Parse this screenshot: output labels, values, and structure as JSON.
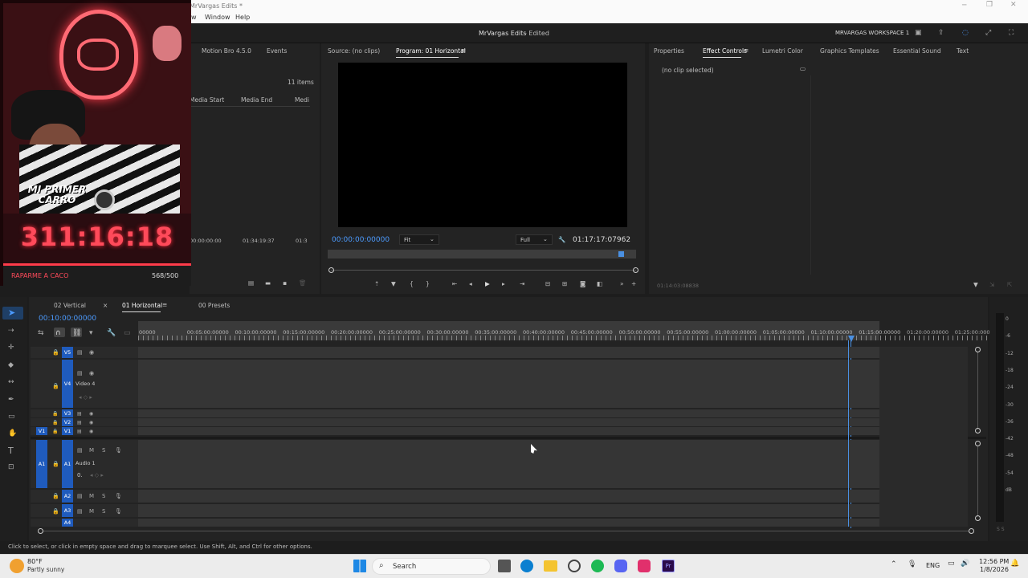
{
  "window": {
    "title_fragment": "MrVargas Edits *",
    "menu_fragment": "w",
    "menu": [
      "Window",
      "Help"
    ]
  },
  "workbar": {
    "project_title": "MrVargas Edits",
    "status": "- Edited",
    "workspace": "MRVARGAS WORKSPACE 1"
  },
  "overlay": {
    "headline": "MI PRIMER\nCARRO",
    "counter": "311:16:18",
    "goal_label": "RAPARME A CACO",
    "goal_count": "568/500"
  },
  "project_panel": {
    "tabs": [
      "Motion Bro 4.5.0",
      "Events"
    ],
    "items_count": "11 items",
    "columns": [
      "Media Start",
      "Media End",
      "Medi"
    ],
    "row": [
      "00:00:00:00",
      "01:34:19:37",
      "01:3"
    ]
  },
  "source_tab": "Source: (no clips)",
  "program_monitor": {
    "tab": "Program: 01 Horizontal",
    "timecode": "00:00:00:00000",
    "fit": "Fit",
    "quality": "Full",
    "duration": "01:17:17:07962"
  },
  "effects_panel": {
    "tabs": [
      "Properties",
      "Effect Controls",
      "Lumetri Color",
      "Graphics Templates",
      "Essential Sound",
      "Text"
    ],
    "active": "Effect Controls",
    "no_clip": "(no clip selected)",
    "timecode": "01:14:03:08838"
  },
  "timeline": {
    "tabs": [
      "02 Vertical",
      "01 Horizontal",
      "00 Presets"
    ],
    "active": "01 Horizontal",
    "timecode": "00:10:00:00000",
    "ruler": [
      "00000",
      "00:05:00:00000",
      "00:10:00:00000",
      "00:15:00:00000",
      "00:20:00:00000",
      "00:25:00:00000",
      "00:30:00:00000",
      "00:35:00:00000",
      "00:40:00:00000",
      "00:45:00:00000",
      "00:50:00:00000",
      "00:55:00:00000",
      "01:00:00:00000",
      "01:05:00:00000",
      "01:10:00:00000",
      "01:15:00:00000",
      "01:20:00:00000",
      "01:25:00:00000"
    ],
    "video_tracks": [
      {
        "id": "V5",
        "name": ""
      },
      {
        "id": "V4",
        "name": "Video 4"
      },
      {
        "id": "V3",
        "name": ""
      },
      {
        "id": "V2",
        "name": ""
      },
      {
        "id": "V1",
        "name": ""
      }
    ],
    "audio_tracks": [
      {
        "id": "A1",
        "name": "Audio 1",
        "volume": "0."
      },
      {
        "id": "A2",
        "name": ""
      },
      {
        "id": "A3",
        "name": ""
      },
      {
        "id": "A4",
        "name": ""
      }
    ],
    "source_patch_video": "V1",
    "source_patch_audio": "A1"
  },
  "meter": {
    "scale": [
      "0",
      "-6",
      "-12",
      "-18",
      "-24",
      "-30",
      "-36",
      "-42",
      "-48",
      "-54",
      "dB"
    ],
    "solo": "S S"
  },
  "status_bar": "Click to select, or click in empty space and drag to marquee select. Use Shift, Alt, and Ctrl for other options.",
  "taskbar": {
    "weather_temp": "80°F",
    "weather_desc": "Partly sunny",
    "search": "Search",
    "lang": "ENG",
    "time": "12:56 PM",
    "date": "1/8/2026"
  },
  "colors": {
    "accent": "#1f5bbd",
    "timecode": "#4c9bff",
    "playhead": "#4a90e2",
    "overlay_red": "#ff4a5a"
  }
}
